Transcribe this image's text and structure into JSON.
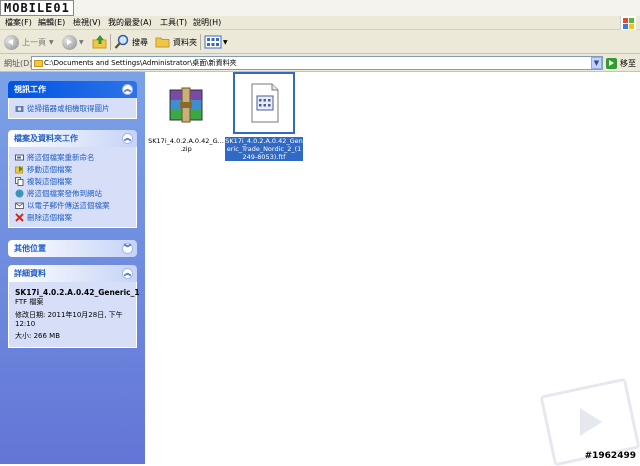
{
  "watermark": {
    "logo": "MOBILE01",
    "post_id": "#1962499"
  },
  "menubar": {
    "items": [
      "檔案(F)",
      "編輯(E)",
      "檢視(V)",
      "我的最愛(A)",
      "工具(T)",
      "說明(H)"
    ]
  },
  "toolbar": {
    "back_label": "上一頁",
    "search_label": "搜尋",
    "folders_label": "資料夾"
  },
  "address": {
    "label": "網址(D)",
    "path": "C:\\Documents and Settings\\Administrator\\桌面\\新資料夾",
    "go_label": "移至"
  },
  "taskpane": {
    "scan_panel": {
      "title": "視訊工作",
      "items": [
        "從掃描器或相機取得圖片"
      ]
    },
    "file_tasks": {
      "title": "檔案及資料夾工作",
      "items": [
        "將這個檔案重新命名",
        "移動這個檔案",
        "複製這個檔案",
        "將這個檔案發佈到網站",
        "以電子郵件傳送這個檔案",
        "刪除這個檔案"
      ]
    },
    "other_places": {
      "title": "其他位置"
    },
    "details": {
      "title": "詳細資料",
      "name": "SK17i_4.0.2.A.0.42_Generic_1",
      "type": "FTF 檔案",
      "modified": "修改日期: 2011年10月28日, 下午 12:10",
      "size": "大小: 266 MB"
    }
  },
  "files": [
    {
      "name": "SK17i_4.0.2.A.0.42_G... .zip",
      "icon": "winrar-archive-icon",
      "selected": false
    },
    {
      "name": "SK17i_4.0.2.A.0.42_Generic_Trade_Nordic_2_(1249-8053).ftf",
      "icon": "generic-file-icon",
      "selected": true
    }
  ],
  "colors": {
    "selection": "#316ac5",
    "pane_top": "#7ba2e7",
    "pane_bottom": "#6375d6",
    "link": "#215dc6"
  }
}
